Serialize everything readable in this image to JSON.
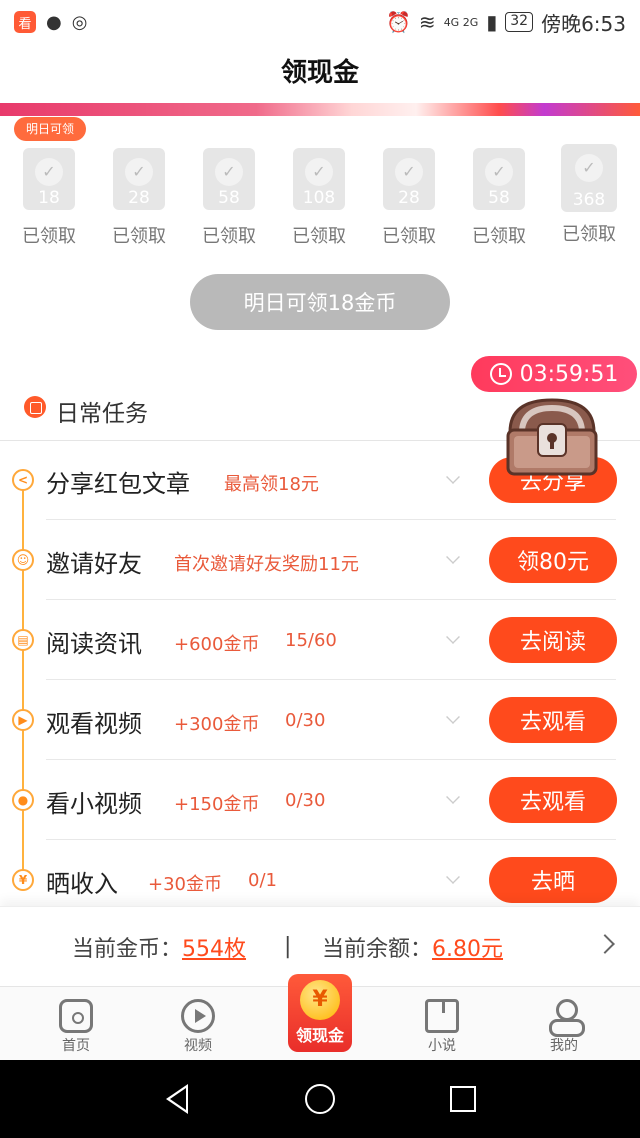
{
  "status_bar": {
    "app_badge": "看",
    "network": "4G 2G",
    "battery": "32",
    "time": "傍晚6:53"
  },
  "header": {
    "title": "领现金"
  },
  "checkin": {
    "tomorrow_tag": "明日可领",
    "days": [
      {
        "coins": "18",
        "label": "已领取"
      },
      {
        "coins": "28",
        "label": "已领取"
      },
      {
        "coins": "58",
        "label": "已领取"
      },
      {
        "coins": "108",
        "label": "已领取"
      },
      {
        "coins": "28",
        "label": "已领取"
      },
      {
        "coins": "58",
        "label": "已领取"
      },
      {
        "coins": "368",
        "label": "已领取"
      }
    ],
    "tomorrow_button": "明日可领18金币"
  },
  "timer": "03:59:51",
  "tasks_section": {
    "title": "日常任务"
  },
  "tasks": [
    {
      "icon": "share-icon",
      "name": "分享红包文章",
      "reward": "最高领18元",
      "progress": "",
      "button": "去分享"
    },
    {
      "icon": "invite-icon",
      "name": "邀请好友",
      "reward": "首次邀请好友奖励11元",
      "progress": "",
      "button": "领80元"
    },
    {
      "icon": "read-icon",
      "name": "阅读资讯",
      "reward": "+600金币",
      "progress": "15/60",
      "button": "去阅读"
    },
    {
      "icon": "play-icon",
      "name": "观看视频",
      "reward": "+300金币",
      "progress": "0/30",
      "button": "去观看"
    },
    {
      "icon": "record-icon",
      "name": "看小视频",
      "reward": "+150金币",
      "progress": "0/30",
      "button": "去观看"
    },
    {
      "icon": "yen-icon",
      "name": "晒收入",
      "reward": "+30金币",
      "progress": "0/1",
      "button": "去晒"
    }
  ],
  "balance": {
    "coins_label": "当前金币：",
    "coins_value": "554枚",
    "divider": "|",
    "cash_label": "当前余额：",
    "cash_value": "6.80元"
  },
  "nav": {
    "home": "首页",
    "video": "视频",
    "center": "领现金",
    "center_symbol": "¥",
    "novel": "小说",
    "me": "我的"
  },
  "colors": {
    "accent": "#ff4a1c",
    "timeline": "#ffb23e"
  }
}
